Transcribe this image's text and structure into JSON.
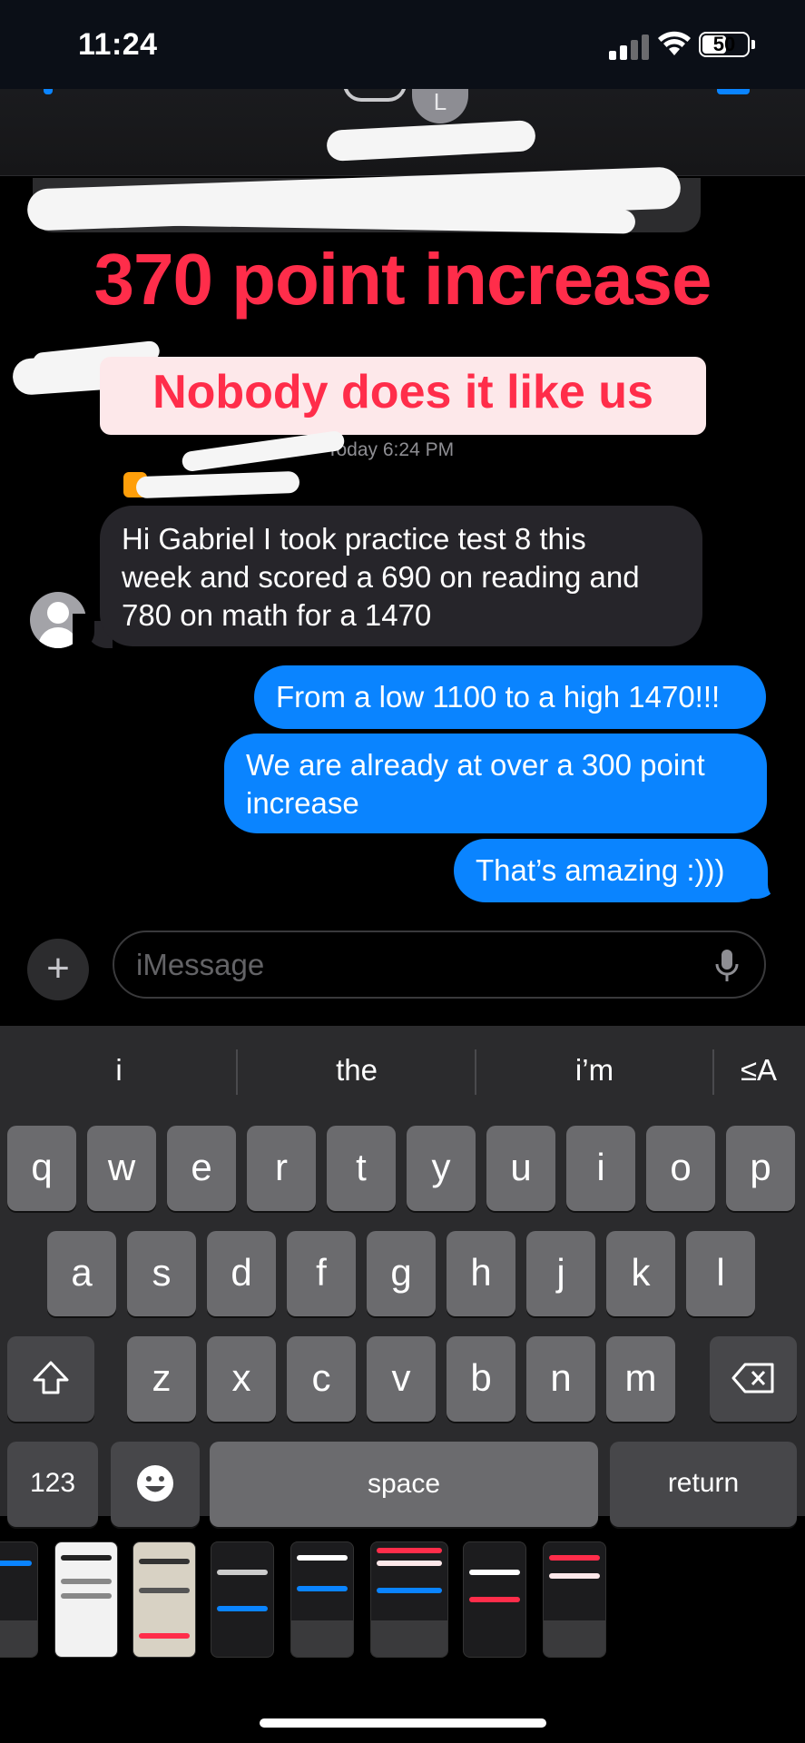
{
  "status_bar": {
    "time": "11:24",
    "battery": "50"
  },
  "header": {
    "contact_initial": "L"
  },
  "overlay": {
    "headline": "370 point increase",
    "subheadline": "Nobody does it like us",
    "headline_color": "#ff2d4a",
    "sub_bg": "#fde8ea"
  },
  "conversation": {
    "timestamp": "Today 6:24 PM",
    "incoming": [
      {
        "lines": [
          "Hi Gabriel I took practice test 8 this",
          "week and scored a 690 on reading and",
          "780 on math for a 1470"
        ]
      }
    ],
    "outgoing": [
      {
        "lines": [
          "From a low 1100 to a high 1470!!!"
        ]
      },
      {
        "lines": [
          "We are already at over a 300 point",
          "increase"
        ]
      },
      {
        "lines": [
          "That’s amazing :)))"
        ]
      }
    ]
  },
  "composer": {
    "placeholder": "iMessage",
    "plus_icon": "plus-icon",
    "mic_icon": "microphone-icon"
  },
  "keyboard": {
    "suggestions": [
      "i",
      "the",
      "i’m"
    ],
    "format_label": "≤A",
    "rows": [
      [
        "q",
        "w",
        "e",
        "r",
        "t",
        "y",
        "u",
        "i",
        "o",
        "p"
      ],
      [
        "a",
        "s",
        "d",
        "f",
        "g",
        "h",
        "j",
        "k",
        "l"
      ],
      [
        "z",
        "x",
        "c",
        "v",
        "b",
        "n",
        "m"
      ]
    ],
    "numbers_label": "123",
    "space_label": "space",
    "return_label": "return",
    "shift_icon": "shift-icon",
    "delete_icon": "delete-icon",
    "emoji_icon": "emoji-icon"
  },
  "colors": {
    "outgoing_bubble": "#0a84ff",
    "incoming_bubble": "#26252a",
    "keyboard_bg": "#2b2b2d"
  }
}
